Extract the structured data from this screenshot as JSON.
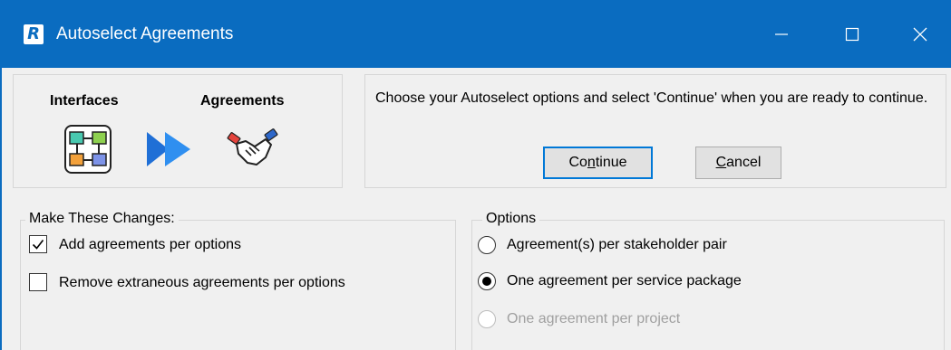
{
  "window": {
    "title": "Autoselect Agreements",
    "app_logo_letter": "R",
    "controls": [
      "minimize-icon",
      "maximize-icon",
      "close-icon"
    ]
  },
  "header": {
    "interfaces_label": "Interfaces",
    "agreements_label": "Agreements",
    "message": "Choose your Autoselect options and select 'Continue' when you are ready to continue."
  },
  "buttons": {
    "continue_pre": "Co",
    "continue_mnemonic": "n",
    "continue_post": "tinue",
    "cancel_mnemonic": "C",
    "cancel_post": "ancel"
  },
  "changes": {
    "caption": "Make These Changes:",
    "items": [
      {
        "label": "Add agreements per options",
        "checked": true
      },
      {
        "label": "Remove extraneous agreements per options",
        "checked": false
      }
    ]
  },
  "options": {
    "caption": "Options",
    "items": [
      {
        "label": "Agreement(s) per stakeholder pair",
        "selected": false,
        "enabled": true
      },
      {
        "label": "One agreement per service package",
        "selected": true,
        "enabled": true
      },
      {
        "label": "One agreement per project",
        "selected": false,
        "enabled": false
      }
    ]
  },
  "colors": {
    "titlebar": "#0a6cc0",
    "accent": "#0078d7",
    "disabled_text": "#a0a0a0"
  }
}
